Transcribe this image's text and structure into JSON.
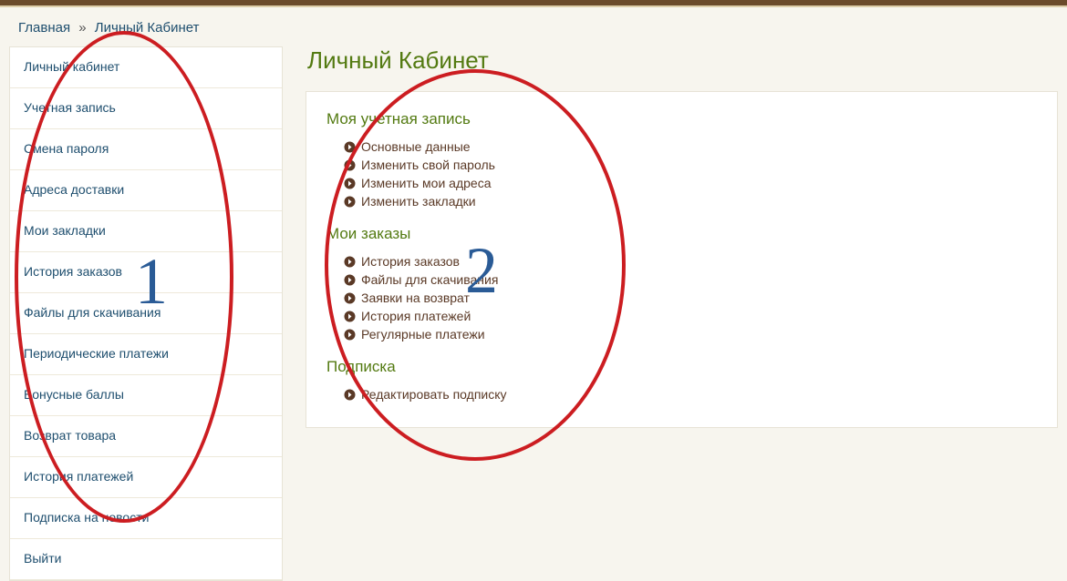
{
  "breadcrumb": {
    "home": "Главная",
    "current": "Личный Кабинет"
  },
  "sidebar": {
    "items": [
      {
        "label": "Личный кабинет"
      },
      {
        "label": "Учетная запись"
      },
      {
        "label": "Смена пароля"
      },
      {
        "label": "Адреса доставки"
      },
      {
        "label": "Мои закладки"
      },
      {
        "label": "История заказов"
      },
      {
        "label": "Файлы для скачивания"
      },
      {
        "label": "Периодические платежи"
      },
      {
        "label": "Бонусные баллы"
      },
      {
        "label": "Возврат товара"
      },
      {
        "label": "История платежей"
      },
      {
        "label": "Подписка на новости"
      },
      {
        "label": "Выйти"
      }
    ]
  },
  "page": {
    "title": "Личный Кабинет"
  },
  "sections": [
    {
      "title": "Моя учетная запись",
      "links": [
        "Основные данные",
        "Изменить свой пароль",
        "Изменить мои адреса",
        "Изменить закладки"
      ]
    },
    {
      "title": "Мои заказы",
      "links": [
        "История заказов",
        "Файлы для скачивания",
        "Заявки на возврат",
        "История платежей",
        "Регулярные платежи"
      ]
    },
    {
      "title": "Подписка",
      "links": [
        "Редактировать подписку"
      ]
    }
  ],
  "annotations": {
    "num1": "1",
    "num2": "2"
  }
}
